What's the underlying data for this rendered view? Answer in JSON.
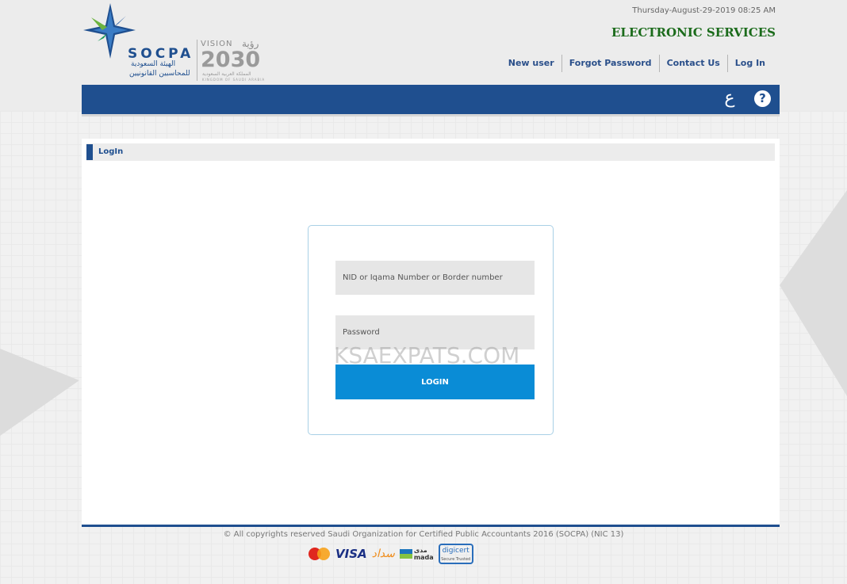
{
  "header": {
    "brand": "SOCPA",
    "brand_ar_line1": "الهيئة السعودية",
    "brand_ar_line2": "للمحاسبين القانونيين",
    "vision_label": "VISION",
    "vision_ar": "رؤية",
    "vision_year": "2030",
    "kingdom_ar": "المملكة العربية السعودية",
    "kingdom_en": "KINGDOM OF SAUDI ARABIA",
    "datetime": "Thursday-August-29-2019 08:25 AM",
    "service_title": "ELECTRONIC SERVICES",
    "nav": [
      {
        "label": "New user"
      },
      {
        "label": "Forgot Password"
      },
      {
        "label": "Contact Us"
      },
      {
        "label": "Log In"
      }
    ]
  },
  "toolbar": {
    "language_toggle": "ع",
    "help_label": "?"
  },
  "section": {
    "title": "LogIn"
  },
  "login": {
    "nid_placeholder": "NID or Iqama Number or Border number",
    "password_placeholder": "Password",
    "button_label": "LOGIN",
    "watermark": "KSAEXPATS.COM"
  },
  "footer": {
    "copyright": "© All copyrights reserved Saudi Organization for Certified Public Accountants 2016 (SOCPA) (NIC 13)",
    "visa": "VISA",
    "sadad": "سداد",
    "mada_ar": "مدى",
    "mada_en": "mada",
    "digicert": "digicert",
    "digicert_sub": "Secure Trusted"
  },
  "colors": {
    "brand_blue": "#1f4f8f",
    "login_blue": "#0a8cd6",
    "service_green": "#1b6b1b"
  }
}
